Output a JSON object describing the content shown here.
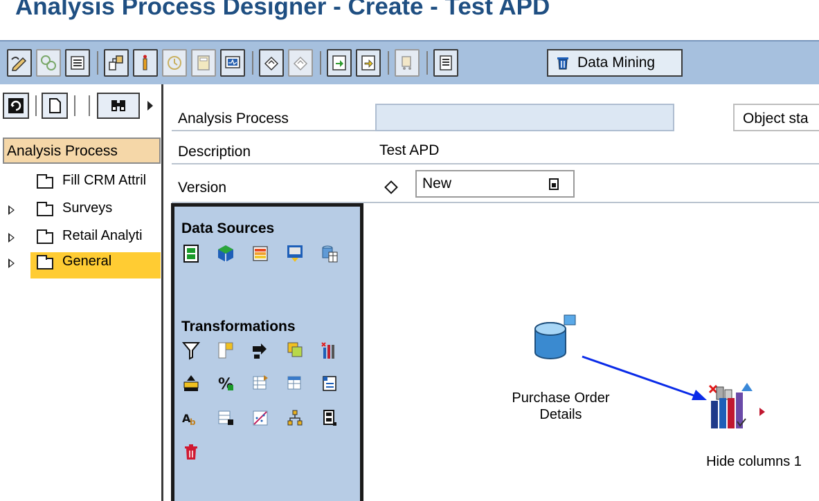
{
  "window": {
    "title": "Analysis Process Designer - Create - Test APD"
  },
  "toolbar": {
    "data_mining_label": "Data Mining",
    "buttons": [
      {
        "icon": "edit-pencil-icon",
        "enabled": true
      },
      {
        "icon": "activate-icon",
        "enabled": false
      },
      {
        "icon": "display-log-icon",
        "enabled": true
      },
      {
        "icon": "where-used-icon",
        "enabled": true
      },
      {
        "icon": "check-icon",
        "enabled": true
      },
      {
        "icon": "schedule-icon",
        "enabled": false
      },
      {
        "icon": "calculator-icon",
        "enabled": false
      },
      {
        "icon": "monitor-icon",
        "enabled": true
      },
      {
        "icon": "undo-icon",
        "enabled": true
      },
      {
        "icon": "redo-icon",
        "enabled": false
      },
      {
        "icon": "transport-in-icon",
        "enabled": true
      },
      {
        "icon": "transport-out-icon",
        "enabled": true
      },
      {
        "icon": "transport-truck-icon",
        "enabled": false
      },
      {
        "icon": "documentation-icon",
        "enabled": true
      },
      {
        "icon": "data-mining-icon",
        "enabled": true
      }
    ]
  },
  "tree": {
    "header": "Analysis Process",
    "items": [
      {
        "label": "Fill CRM Attril",
        "expandable": false,
        "selected": false
      },
      {
        "label": "Surveys",
        "expandable": true,
        "selected": false
      },
      {
        "label": "Retail Analyti",
        "expandable": true,
        "selected": false
      },
      {
        "label": "General",
        "expandable": true,
        "selected": true
      }
    ]
  },
  "form": {
    "analysis_process_label": "Analysis Process",
    "analysis_process_value": "",
    "object_status_label": "Object sta",
    "description_label": "Description",
    "description_value": "Test APD",
    "version_label": "Version",
    "version_value": "New"
  },
  "palette": {
    "data_sources_heading": "Data Sources",
    "transformations_heading": "Transformations",
    "data_source_icons": [
      "infoobject-icon",
      "infocube-icon",
      "query-icon",
      "file-icon",
      "database-table-icon"
    ],
    "transformation_icons": [
      "filter-icon",
      "join-icon",
      "union-icon",
      "aggregation-icon",
      "hide-columns-icon",
      "sort-icon",
      "formula-icon",
      "transpose-rows-icon",
      "transpose-cols-icon",
      "list-icon",
      "abap-routine-icon",
      "restrict-icon",
      "regression-icon",
      "hierarchy-icon",
      "lookup-icon",
      "data-mining-icon"
    ]
  },
  "canvas": {
    "nodes": [
      {
        "label_line1": "Purchase Order",
        "label_line2": "Details",
        "icon": "database-table-icon"
      },
      {
        "label": "Hide columns 1",
        "icon": "hide-columns-icon"
      }
    ]
  },
  "colors": {
    "title": "#1f4f82",
    "toolbar_bg": "#a6c0de",
    "palette_bg": "#b7cce5",
    "selection": "#ffcc33",
    "tree_header_bg": "#f5d7a8",
    "connector": "#0a2be8"
  }
}
